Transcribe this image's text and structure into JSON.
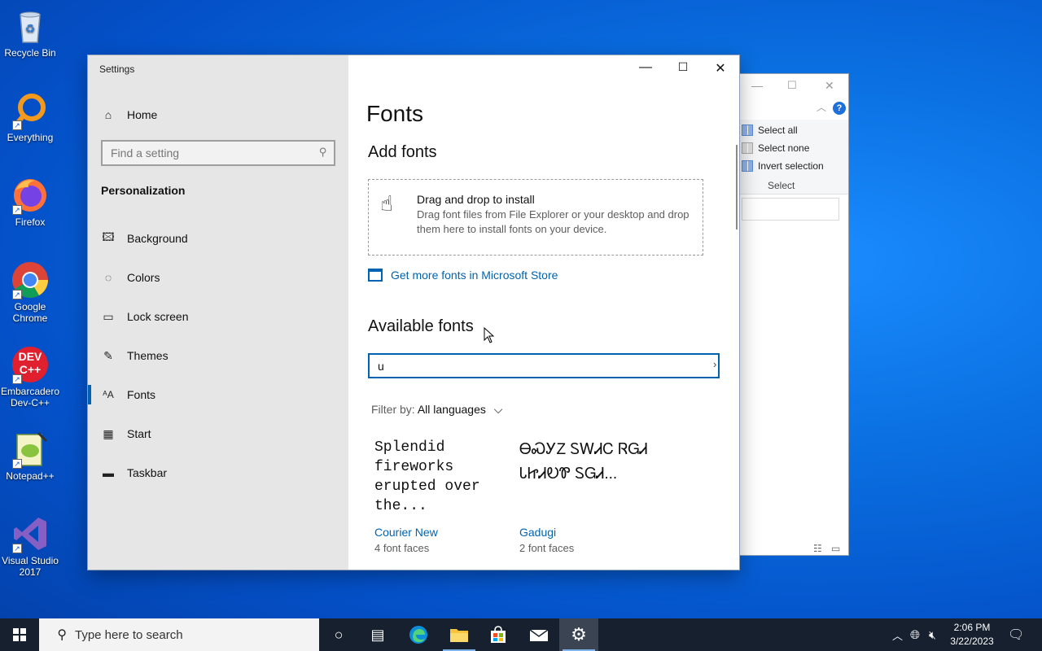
{
  "desktop": {
    "icons": [
      {
        "label": "Recycle Bin"
      },
      {
        "label": "Everything"
      },
      {
        "label": "Firefox"
      },
      {
        "label": "Google Chrome"
      },
      {
        "label": "Embarcadero Dev-C++",
        "logo": "DEV C++"
      },
      {
        "label": "Notepad++"
      },
      {
        "label": "Visual Studio 2017"
      }
    ]
  },
  "explorer": {
    "help": "?",
    "ribbon": {
      "select_all": "Select all",
      "select_none": "Select none",
      "invert_selection": "Invert selection",
      "group_label": "Select"
    }
  },
  "settings": {
    "window_title": "Settings",
    "sidebar": {
      "home": "Home",
      "search_placeholder": "Find a setting",
      "section": "Personalization",
      "items": [
        {
          "label": "Background",
          "icon": "picture-icon"
        },
        {
          "label": "Colors",
          "icon": "palette-icon"
        },
        {
          "label": "Lock screen",
          "icon": "lock-screen-icon"
        },
        {
          "label": "Themes",
          "icon": "brush-icon"
        },
        {
          "label": "Fonts",
          "icon": "fonts-icon",
          "active": true
        },
        {
          "label": "Start",
          "icon": "start-icon"
        },
        {
          "label": "Taskbar",
          "icon": "taskbar-icon"
        }
      ]
    },
    "content": {
      "title": "Fonts",
      "add_fonts": "Add fonts",
      "drop_title": "Drag and drop to install",
      "drop_desc": "Drag font files from File Explorer or your desktop and drop them here to install fonts on your device.",
      "store_link": "Get more fonts in Microsoft Store",
      "available": "Available fonts",
      "search_value": "u",
      "filter_label": "Filter by:",
      "filter_value": "All languages",
      "fonts": [
        {
          "preview": "Splendid fireworks erupted over the...",
          "name": "Courier New",
          "faces": "4 font faces"
        },
        {
          "preview": "ᎾᏍᎩZ ᏚᎳᏗᏟ ᏒᏀᏗ ᏓᏥᏗᎧᏈ ᏚᏀᏗ...",
          "name": "Gadugi",
          "faces": "2 font faces"
        }
      ]
    }
  },
  "taskbar": {
    "search_placeholder": "Type here to search",
    "time": "2:06 PM",
    "date": "3/22/2023"
  },
  "colors": {
    "accent": "#0063b1",
    "sidebar_bg": "#e6e6e6",
    "taskbar_bg": "#16202e"
  }
}
